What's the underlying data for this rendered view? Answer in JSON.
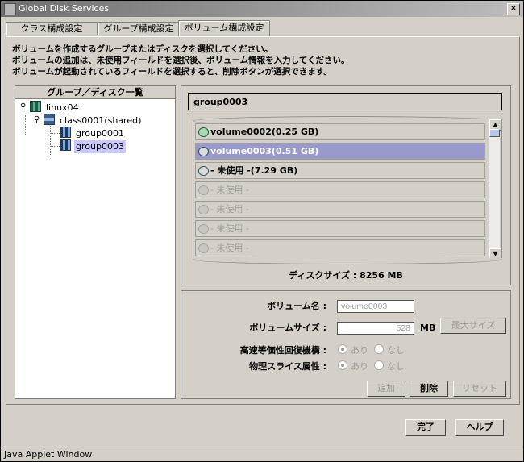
{
  "window": {
    "title": "Global Disk Services",
    "close": "×"
  },
  "tabs": [
    {
      "label": "クラス構成設定"
    },
    {
      "label": "グループ構成設定"
    },
    {
      "label": "ボリューム構成設定"
    }
  ],
  "instructions": [
    "ボリュームを作成するグループまたはディスクを選択してください。",
    "ボリュームの追加は、未使用フィールドを選択後、ボリューム情報を入力してください。",
    "ボリュームが起動されているフィールドを選択すると、削除ボタンが選択できます。"
  ],
  "tree": {
    "header": "グループ／ディスク一覧",
    "host": {
      "toggle": "⚲",
      "label": "linux04"
    },
    "class": {
      "toggle": "⚲",
      "label": "class0001(shared)"
    },
    "groups": [
      {
        "label": "group0001"
      },
      {
        "label": "group0003"
      }
    ]
  },
  "selectedGroup": "group0003",
  "volumes": [
    {
      "label": "volume0002(0.25 GB)"
    },
    {
      "label": "volume0003(0.51 GB)"
    },
    {
      "label": "- 未使用 -(7.29 GB)"
    },
    {
      "label": "- 未使用 -"
    },
    {
      "label": "- 未使用 -"
    },
    {
      "label": "- 未使用 -"
    },
    {
      "label": "- 未使用 -"
    }
  ],
  "scroll": {
    "up": "▲",
    "down": "▼"
  },
  "diskSize": "ディスクサイズ : 8256 MB",
  "form": {
    "volumeNameLabel": "ボリューム名 :",
    "volumeNameValue": "volume0003",
    "volumeSizeLabel": "ボリュームサイズ :",
    "volumeSizeValue": "528",
    "sizeUnit": "MB",
    "maxSizeButton": "最大サイズ",
    "fastResyncLabel": "高速等価性回復機構 :",
    "physicalSliceLabel": "物理スライス属性 :",
    "radioOn": "あり",
    "radioOff": "なし",
    "addButton": "追加",
    "deleteButton": "削除",
    "resetButton": "リセット"
  },
  "footer": {
    "completeButton": "完了",
    "helpButton": "ヘルプ"
  },
  "status": "Java Applet Window"
}
